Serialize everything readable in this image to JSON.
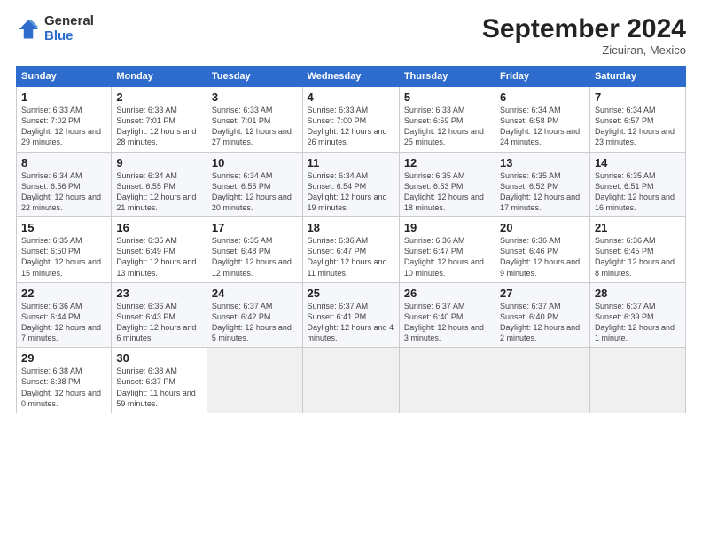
{
  "header": {
    "logo_general": "General",
    "logo_blue": "Blue",
    "month_title": "September 2024",
    "location": "Zicuiran, Mexico"
  },
  "columns": [
    "Sunday",
    "Monday",
    "Tuesday",
    "Wednesday",
    "Thursday",
    "Friday",
    "Saturday"
  ],
  "rows": [
    [
      {
        "day": "1",
        "sunrise": "Sunrise: 6:33 AM",
        "sunset": "Sunset: 7:02 PM",
        "daylight": "Daylight: 12 hours and 29 minutes."
      },
      {
        "day": "2",
        "sunrise": "Sunrise: 6:33 AM",
        "sunset": "Sunset: 7:01 PM",
        "daylight": "Daylight: 12 hours and 28 minutes."
      },
      {
        "day": "3",
        "sunrise": "Sunrise: 6:33 AM",
        "sunset": "Sunset: 7:01 PM",
        "daylight": "Daylight: 12 hours and 27 minutes."
      },
      {
        "day": "4",
        "sunrise": "Sunrise: 6:33 AM",
        "sunset": "Sunset: 7:00 PM",
        "daylight": "Daylight: 12 hours and 26 minutes."
      },
      {
        "day": "5",
        "sunrise": "Sunrise: 6:33 AM",
        "sunset": "Sunset: 6:59 PM",
        "daylight": "Daylight: 12 hours and 25 minutes."
      },
      {
        "day": "6",
        "sunrise": "Sunrise: 6:34 AM",
        "sunset": "Sunset: 6:58 PM",
        "daylight": "Daylight: 12 hours and 24 minutes."
      },
      {
        "day": "7",
        "sunrise": "Sunrise: 6:34 AM",
        "sunset": "Sunset: 6:57 PM",
        "daylight": "Daylight: 12 hours and 23 minutes."
      }
    ],
    [
      {
        "day": "8",
        "sunrise": "Sunrise: 6:34 AM",
        "sunset": "Sunset: 6:56 PM",
        "daylight": "Daylight: 12 hours and 22 minutes."
      },
      {
        "day": "9",
        "sunrise": "Sunrise: 6:34 AM",
        "sunset": "Sunset: 6:55 PM",
        "daylight": "Daylight: 12 hours and 21 minutes."
      },
      {
        "day": "10",
        "sunrise": "Sunrise: 6:34 AM",
        "sunset": "Sunset: 6:55 PM",
        "daylight": "Daylight: 12 hours and 20 minutes."
      },
      {
        "day": "11",
        "sunrise": "Sunrise: 6:34 AM",
        "sunset": "Sunset: 6:54 PM",
        "daylight": "Daylight: 12 hours and 19 minutes."
      },
      {
        "day": "12",
        "sunrise": "Sunrise: 6:35 AM",
        "sunset": "Sunset: 6:53 PM",
        "daylight": "Daylight: 12 hours and 18 minutes."
      },
      {
        "day": "13",
        "sunrise": "Sunrise: 6:35 AM",
        "sunset": "Sunset: 6:52 PM",
        "daylight": "Daylight: 12 hours and 17 minutes."
      },
      {
        "day": "14",
        "sunrise": "Sunrise: 6:35 AM",
        "sunset": "Sunset: 6:51 PM",
        "daylight": "Daylight: 12 hours and 16 minutes."
      }
    ],
    [
      {
        "day": "15",
        "sunrise": "Sunrise: 6:35 AM",
        "sunset": "Sunset: 6:50 PM",
        "daylight": "Daylight: 12 hours and 15 minutes."
      },
      {
        "day": "16",
        "sunrise": "Sunrise: 6:35 AM",
        "sunset": "Sunset: 6:49 PM",
        "daylight": "Daylight: 12 hours and 13 minutes."
      },
      {
        "day": "17",
        "sunrise": "Sunrise: 6:35 AM",
        "sunset": "Sunset: 6:48 PM",
        "daylight": "Daylight: 12 hours and 12 minutes."
      },
      {
        "day": "18",
        "sunrise": "Sunrise: 6:36 AM",
        "sunset": "Sunset: 6:47 PM",
        "daylight": "Daylight: 12 hours and 11 minutes."
      },
      {
        "day": "19",
        "sunrise": "Sunrise: 6:36 AM",
        "sunset": "Sunset: 6:47 PM",
        "daylight": "Daylight: 12 hours and 10 minutes."
      },
      {
        "day": "20",
        "sunrise": "Sunrise: 6:36 AM",
        "sunset": "Sunset: 6:46 PM",
        "daylight": "Daylight: 12 hours and 9 minutes."
      },
      {
        "day": "21",
        "sunrise": "Sunrise: 6:36 AM",
        "sunset": "Sunset: 6:45 PM",
        "daylight": "Daylight: 12 hours and 8 minutes."
      }
    ],
    [
      {
        "day": "22",
        "sunrise": "Sunrise: 6:36 AM",
        "sunset": "Sunset: 6:44 PM",
        "daylight": "Daylight: 12 hours and 7 minutes."
      },
      {
        "day": "23",
        "sunrise": "Sunrise: 6:36 AM",
        "sunset": "Sunset: 6:43 PM",
        "daylight": "Daylight: 12 hours and 6 minutes."
      },
      {
        "day": "24",
        "sunrise": "Sunrise: 6:37 AM",
        "sunset": "Sunset: 6:42 PM",
        "daylight": "Daylight: 12 hours and 5 minutes."
      },
      {
        "day": "25",
        "sunrise": "Sunrise: 6:37 AM",
        "sunset": "Sunset: 6:41 PM",
        "daylight": "Daylight: 12 hours and 4 minutes."
      },
      {
        "day": "26",
        "sunrise": "Sunrise: 6:37 AM",
        "sunset": "Sunset: 6:40 PM",
        "daylight": "Daylight: 12 hours and 3 minutes."
      },
      {
        "day": "27",
        "sunrise": "Sunrise: 6:37 AM",
        "sunset": "Sunset: 6:40 PM",
        "daylight": "Daylight: 12 hours and 2 minutes."
      },
      {
        "day": "28",
        "sunrise": "Sunrise: 6:37 AM",
        "sunset": "Sunset: 6:39 PM",
        "daylight": "Daylight: 12 hours and 1 minute."
      }
    ],
    [
      {
        "day": "29",
        "sunrise": "Sunrise: 6:38 AM",
        "sunset": "Sunset: 6:38 PM",
        "daylight": "Daylight: 12 hours and 0 minutes."
      },
      {
        "day": "30",
        "sunrise": "Sunrise: 6:38 AM",
        "sunset": "Sunset: 6:37 PM",
        "daylight": "Daylight: 11 hours and 59 minutes."
      },
      null,
      null,
      null,
      null,
      null
    ]
  ]
}
